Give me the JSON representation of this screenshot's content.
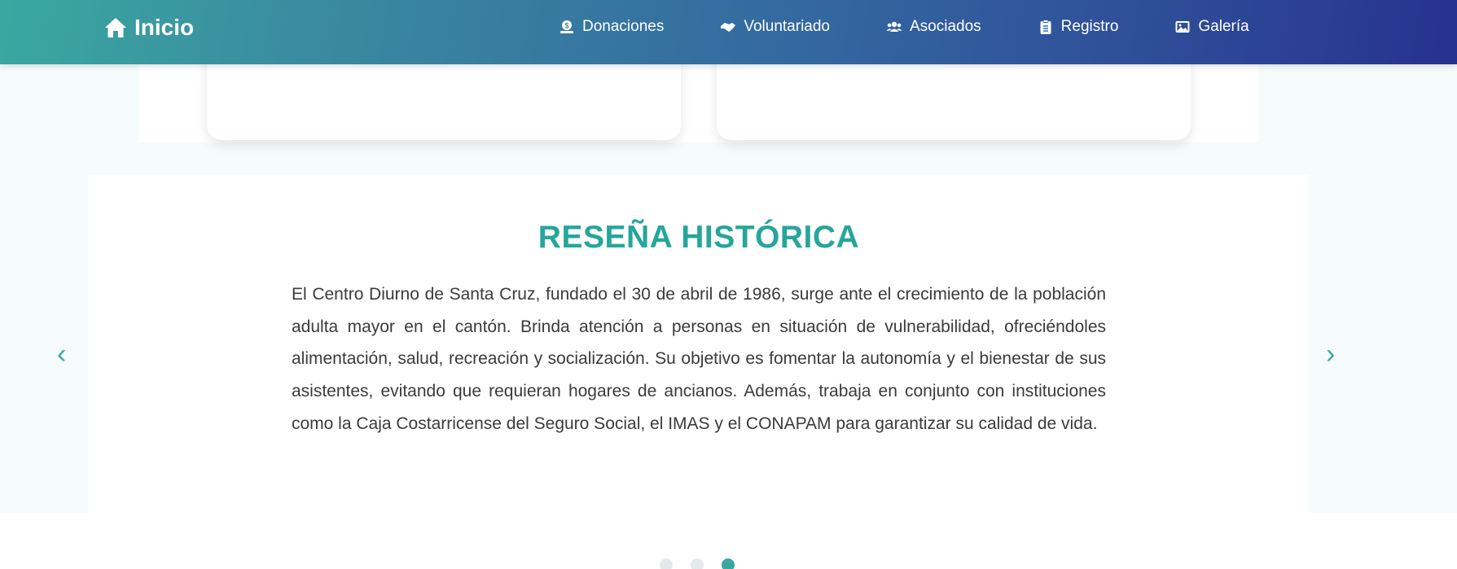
{
  "nav": {
    "brand": "Inicio",
    "links": [
      {
        "label": "Donaciones"
      },
      {
        "label": "Voluntariado"
      },
      {
        "label": "Asociados"
      },
      {
        "label": "Registro"
      },
      {
        "label": "Galería"
      }
    ]
  },
  "slide": {
    "title": "RESEÑA HISTÓRICA",
    "text": "El Centro Diurno de Santa Cruz, fundado el 30 de abril de 1986, surge ante el crecimiento de la población adulta mayor en el cantón. Brinda atención a personas en situación de vulnerabilidad, ofreciéndoles alimentación, salud, recreación y socialización. Su objetivo es fomentar la autonomía y el bienestar de sus asistentes, evitando que requieran hogares de ancianos. Además, trabaja en conjunto con instituciones como la Caja Costarricense del Seguro Social, el IMAS y el CONAPAM para garantizar su calidad de vida."
  },
  "carousel": {
    "prev": "‹",
    "next": "›",
    "active_index": 2
  },
  "colors": {
    "accent": "#26a69a",
    "nav_start": "#3aa8a0",
    "nav_end": "#27318f"
  }
}
